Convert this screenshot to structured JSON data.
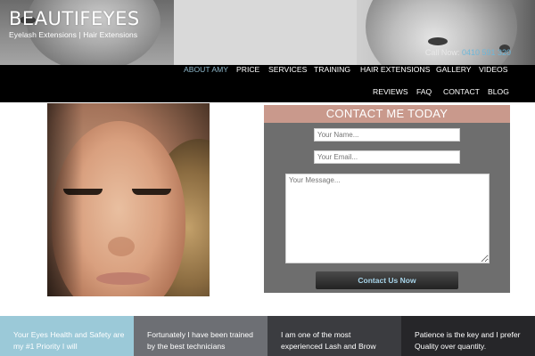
{
  "header": {
    "logo": "BEAUTIFEYES",
    "tagline": "Eyelash Extensions | Hair Extensions",
    "phone_label": "Call Now:",
    "phone_number": "0410 591 320"
  },
  "nav": {
    "items": [
      {
        "label": "ABOUT AMY",
        "active": true
      },
      {
        "label": "PRICE"
      },
      {
        "label": "SERVICES"
      },
      {
        "label": "TRAINING"
      },
      {
        "label": "HAIR EXTENSIONS"
      },
      {
        "label": "GALLERY"
      },
      {
        "label": "VIDEOS"
      },
      {
        "label": "REVIEWS"
      },
      {
        "label": "FAQ"
      },
      {
        "label": "CONTACT"
      },
      {
        "label": "BLOG"
      }
    ]
  },
  "contact": {
    "title": "CONTACT ME TODAY",
    "name_placeholder": "Your Name...",
    "email_placeholder": "Your Email...",
    "message_placeholder": "Your Message...",
    "submit_label": "Contact Us Now"
  },
  "features": [
    {
      "text": "Your Eyes Health and Safety are my #1 Priority I will"
    },
    {
      "text": "Fortunately I have been trained by the best technicians"
    },
    {
      "text": "I am one of the most experienced Lash and Brow"
    },
    {
      "text": "Patience is the key and I prefer Quality over quantity."
    }
  ],
  "colors": {
    "nav_background": "#000000",
    "nav_active": "#8fb9cc",
    "form_title_background": "#c9998c",
    "form_background": "#6e6e6e",
    "button_text": "#a6d3e8",
    "strip_1": "#9bc9d8",
    "strip_2": "#6d6f74",
    "strip_3": "#3b3c40",
    "strip_4": "#262629"
  }
}
